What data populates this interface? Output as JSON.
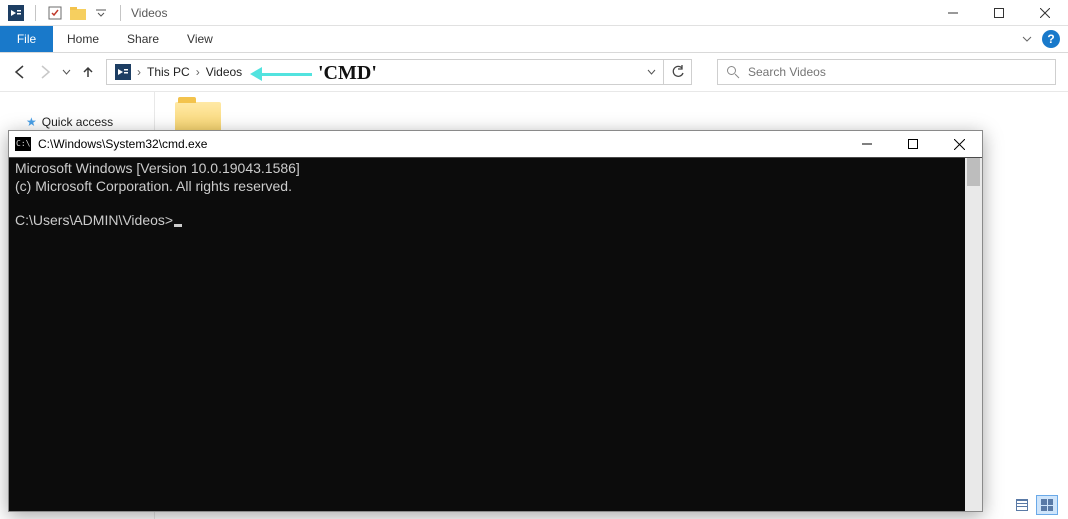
{
  "explorer": {
    "window_title": "Videos",
    "tabs": {
      "file": "File",
      "home": "Home",
      "share": "Share",
      "view": "View"
    },
    "breadcrumbs": [
      "This PC",
      "Videos"
    ],
    "search_placeholder": "Search Videos",
    "nav_pane": {
      "quick_access": "Quick access"
    }
  },
  "annotation": {
    "label": "'CMD'"
  },
  "cmd": {
    "title": "C:\\Windows\\System32\\cmd.exe",
    "line1": "Microsoft Windows [Version 10.0.19043.1586]",
    "line2": "(c) Microsoft Corporation. All rights reserved.",
    "prompt": "C:\\Users\\ADMIN\\Videos>"
  }
}
